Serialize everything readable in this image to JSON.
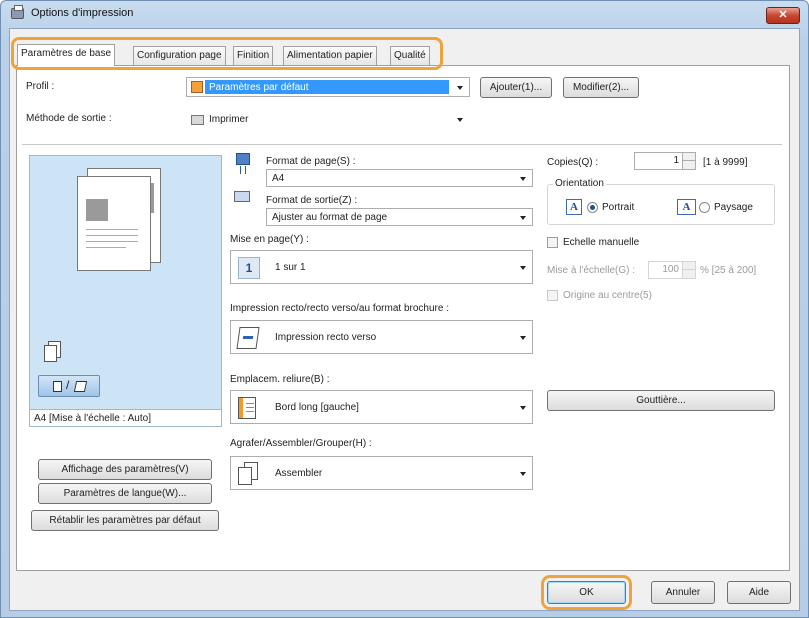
{
  "window": {
    "title": "Options d'impression",
    "close_symbol": "✕"
  },
  "tabs": [
    {
      "label": "Paramètres de base",
      "active": true
    },
    {
      "label": "Configuration page"
    },
    {
      "label": "Finition"
    },
    {
      "label": "Alimentation papier"
    },
    {
      "label": "Qualité"
    }
  ],
  "profile": {
    "label": "Profil :",
    "value": "Paramètres par défaut",
    "add_button": "Ajouter(1)...",
    "edit_button": "Modifier(2)..."
  },
  "output": {
    "label": "Méthode de sortie :",
    "value": "Imprimer"
  },
  "preview": {
    "caption": "A4 [Mise à l'échelle : Auto]"
  },
  "left_buttons": {
    "show_settings": "Affichage des paramètres(V)",
    "language": "Paramètres de langue(W)...",
    "restore": "Rétablir les paramètres par défaut"
  },
  "page_size": {
    "label": "Format de page(S) :",
    "value": "A4"
  },
  "output_size": {
    "label": "Format de sortie(Z) :",
    "value": "Ajuster au format de page"
  },
  "layout": {
    "label": "Mise en page(Y) :",
    "value": "1 sur 1",
    "icon_text": "1"
  },
  "duplex": {
    "label": "Impression recto/recto verso/au format brochure :",
    "value": "Impression recto verso"
  },
  "binding": {
    "label": "Emplacem. reliure(B) :",
    "value": "Bord long [gauche]"
  },
  "staple": {
    "label": "Agrafer/Assembler/Grouper(H) :",
    "value": "Assembler"
  },
  "copies": {
    "label": "Copies(Q) :",
    "value": "1",
    "range": "[1 à 9999]"
  },
  "orientation": {
    "group_label": "Orientation",
    "portrait": "Portrait",
    "landscape": "Paysage",
    "icon_letter": "A",
    "selected": "portrait"
  },
  "manual_scale": {
    "label": "Echelle manuelle",
    "scale_label": "Mise à l'échelle(G) :",
    "scale_value": "100",
    "scale_range": "% [25 à 200]",
    "center_label": "Origine au centre(5)"
  },
  "gutter_button": "Gouttière...",
  "footer": {
    "ok": "OK",
    "cancel": "Annuler",
    "help": "Aide"
  },
  "colors": {
    "highlight": "#f0a23c",
    "selection": "#3399ff",
    "preview_bg": "#cde4f7"
  }
}
